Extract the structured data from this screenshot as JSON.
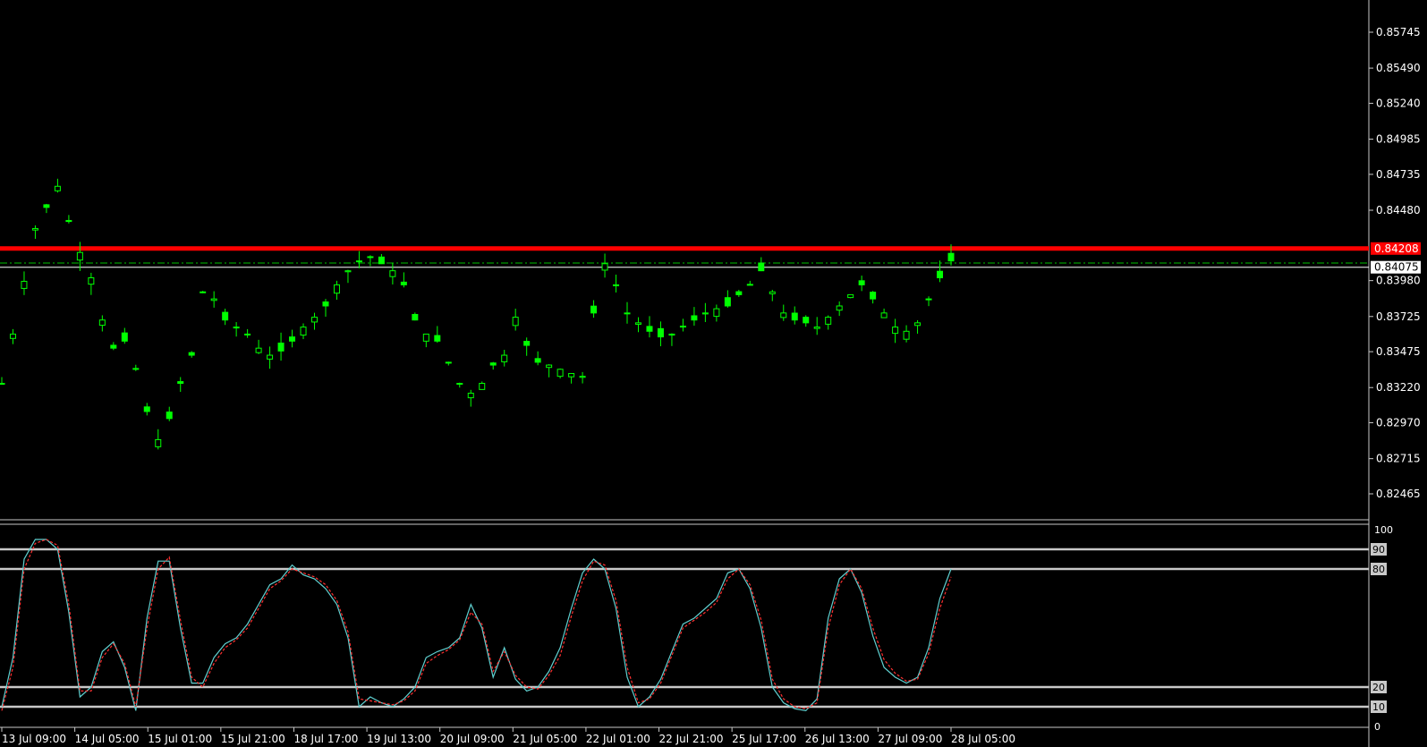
{
  "chart_data": [
    {
      "type": "candlestick",
      "title": "",
      "ylim": [
        0.8234,
        0.8587
      ],
      "y_ticks": [
        "0.85745",
        "0.85490",
        "0.85240",
        "0.84985",
        "0.84735",
        "0.84480",
        "0.83980",
        "0.83725",
        "0.83475",
        "0.83220",
        "0.82970",
        "0.82715",
        "0.82465"
      ],
      "x_ticks": [
        "13 Jul 09:00",
        "14 Jul 05:00",
        "15 Jul 01:00",
        "15 Jul 21:00",
        "18 Jul 17:00",
        "19 Jul 13:00",
        "20 Jul 09:00",
        "21 Jul 05:00",
        "22 Jul 01:00",
        "22 Jul 21:00",
        "25 Jul 17:00",
        "26 Jul 13:00",
        "27 Jul 09:00",
        "28 Jul 05:00"
      ],
      "candle_color": "#00ff00",
      "grid": false,
      "horizontal_lines": [
        {
          "value": 0.84208,
          "label": "0.84208",
          "color": "#ff0000",
          "style": "solid"
        },
        {
          "value": 0.84105,
          "color": "#00c000",
          "style": "dash-dot"
        },
        {
          "value": 0.84075,
          "label": "0.84075",
          "color": "#ffffff",
          "style": "solid"
        }
      ],
      "close_path": [
        [
          0,
          0.8325
        ],
        [
          1,
          0.836
        ],
        [
          3,
          0.8435
        ],
        [
          4,
          0.845
        ],
        [
          5,
          0.8465
        ],
        [
          6,
          0.844
        ],
        [
          7,
          0.8418
        ],
        [
          8,
          0.84
        ],
        [
          9,
          0.837
        ],
        [
          10,
          0.835
        ],
        [
          11,
          0.8355
        ],
        [
          12,
          0.8335
        ],
        [
          13,
          0.8305
        ],
        [
          14,
          0.8285
        ],
        [
          15,
          0.83
        ],
        [
          16,
          0.8325
        ],
        [
          17,
          0.8345
        ],
        [
          18,
          0.839
        ],
        [
          19,
          0.8385
        ],
        [
          20,
          0.837
        ],
        [
          21,
          0.8365
        ],
        [
          22,
          0.836
        ],
        [
          23,
          0.835
        ],
        [
          24,
          0.8345
        ],
        [
          25,
          0.8348
        ],
        [
          26,
          0.8355
        ],
        [
          27,
          0.8365
        ],
        [
          28,
          0.8372
        ],
        [
          29,
          0.838
        ],
        [
          30,
          0.8395
        ],
        [
          31,
          0.8405
        ],
        [
          32,
          0.8412
        ],
        [
          33,
          0.8415
        ],
        [
          34,
          0.841
        ],
        [
          35,
          0.8405
        ],
        [
          36,
          0.8395
        ],
        [
          37,
          0.837
        ],
        [
          38,
          0.836
        ],
        [
          39,
          0.8355
        ],
        [
          40,
          0.834
        ],
        [
          41,
          0.8325
        ],
        [
          42,
          0.8318
        ],
        [
          43,
          0.8325
        ],
        [
          44,
          0.8338
        ],
        [
          45,
          0.8345
        ],
        [
          46,
          0.8372
        ],
        [
          47,
          0.8352
        ],
        [
          48,
          0.834
        ],
        [
          49,
          0.8338
        ],
        [
          50,
          0.8335
        ],
        [
          51,
          0.8332
        ],
        [
          52,
          0.833
        ],
        [
          53,
          0.8375
        ],
        [
          54,
          0.841
        ],
        [
          55,
          0.8395
        ],
        [
          56,
          0.8375
        ],
        [
          57,
          0.8368
        ],
        [
          58,
          0.8362
        ],
        [
          59,
          0.8358
        ],
        [
          60,
          0.836
        ],
        [
          61,
          0.8365
        ],
        [
          62,
          0.837
        ],
        [
          63,
          0.8375
        ],
        [
          64,
          0.8378
        ],
        [
          65,
          0.838
        ],
        [
          66,
          0.8388
        ],
        [
          67,
          0.8395
        ],
        [
          68,
          0.8405
        ],
        [
          69,
          0.839
        ],
        [
          70,
          0.8375
        ],
        [
          71,
          0.837
        ],
        [
          72,
          0.8368
        ],
        [
          73,
          0.8365
        ],
        [
          74,
          0.8372
        ],
        [
          75,
          0.838
        ],
        [
          76,
          0.8388
        ],
        [
          77,
          0.8395
        ],
        [
          78,
          0.8385
        ],
        [
          79,
          0.8375
        ],
        [
          80,
          0.8365
        ],
        [
          81,
          0.8362
        ],
        [
          82,
          0.8368
        ],
        [
          83,
          0.8385
        ],
        [
          84,
          0.84
        ],
        [
          85,
          0.8412
        ]
      ],
      "candle_count": 86
    },
    {
      "type": "line",
      "title": "",
      "ylim": [
        0,
        100
      ],
      "y_ticks": [
        "100",
        "90",
        "80",
        "20",
        "10",
        "0"
      ],
      "levels": [
        90,
        80,
        20,
        10
      ],
      "series": [
        {
          "color": "#5fd0d0",
          "values": [
            10,
            35,
            85,
            95,
            95,
            90,
            58,
            15,
            20,
            38,
            43,
            30,
            8,
            55,
            84,
            84,
            50,
            22,
            22,
            35,
            42,
            45,
            52,
            62,
            72,
            75,
            82,
            77,
            75,
            70,
            62,
            45,
            10,
            15,
            12,
            10,
            14,
            20,
            35,
            38,
            40,
            45,
            62,
            50,
            25,
            40,
            24,
            18,
            20,
            28,
            40,
            60,
            78,
            85,
            80,
            60,
            25,
            10,
            15,
            24,
            38,
            52,
            55,
            60,
            65,
            78,
            80,
            70,
            50,
            20,
            12,
            9,
            8,
            14,
            55,
            75,
            80,
            68,
            46,
            30,
            25,
            22,
            25,
            40,
            65,
            80
          ]
        },
        {
          "color": "#ff3030",
          "dashed": true,
          "values": [
            8,
            30,
            80,
            93,
            95,
            92,
            62,
            18,
            18,
            35,
            42,
            32,
            10,
            50,
            80,
            86,
            54,
            25,
            20,
            32,
            40,
            44,
            50,
            60,
            70,
            74,
            80,
            78,
            76,
            72,
            64,
            48,
            14,
            13,
            12,
            11,
            13,
            18,
            32,
            36,
            39,
            44,
            58,
            52,
            28,
            38,
            26,
            20,
            19,
            26,
            36,
            56,
            74,
            84,
            82,
            64,
            30,
            12,
            14,
            22,
            36,
            50,
            54,
            58,
            63,
            75,
            80,
            72,
            54,
            24,
            14,
            10,
            9,
            12,
            50,
            72,
            80,
            70,
            50,
            34,
            27,
            23,
            24,
            37,
            60,
            76
          ]
        }
      ]
    }
  ]
}
